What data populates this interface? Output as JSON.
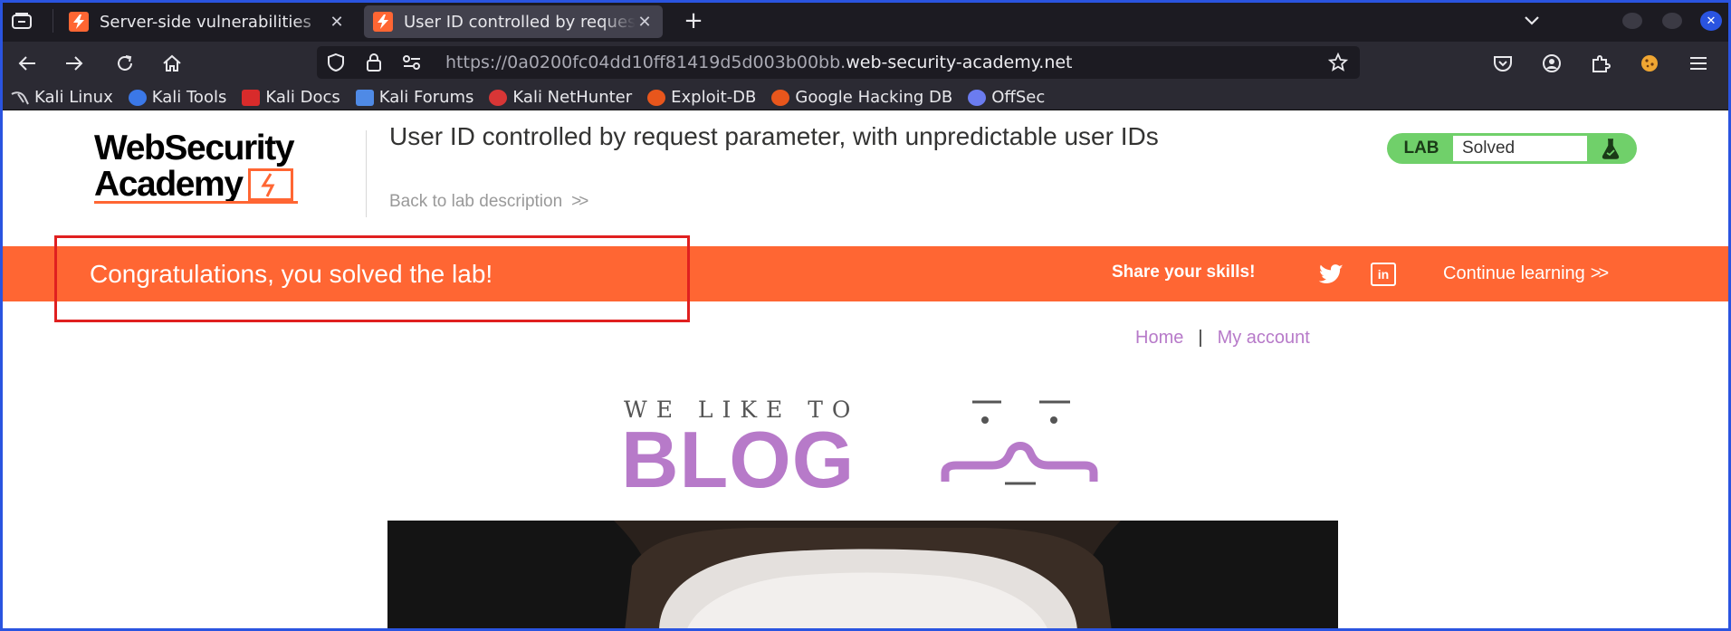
{
  "browser": {
    "tabs": [
      {
        "title": "Server-side vulnerabilities",
        "active": false
      },
      {
        "title": "User ID controlled by request parameter, with unpredictable user IDs",
        "active": true
      }
    ],
    "url_prefix": "https://0a0200fc04dd10ff81419d5d003b00bb.",
    "url_domain": "web-security-academy.net",
    "bookmarks": [
      {
        "label": "Kali Linux",
        "icon": "kali-dragon-icon",
        "color": "#1c1b22"
      },
      {
        "label": "Kali Tools",
        "icon": "kali-tools-icon",
        "color": "#3b78e7"
      },
      {
        "label": "Kali Docs",
        "icon": "kali-docs-icon",
        "color": "#d82b2b"
      },
      {
        "label": "Kali Forums",
        "icon": "kali-forums-icon",
        "color": "#4f8ae6"
      },
      {
        "label": "Kali NetHunter",
        "icon": "kali-nethunter-icon",
        "color": "#d83636"
      },
      {
        "label": "Exploit-DB",
        "icon": "exploit-db-icon",
        "color": "#e8561c"
      },
      {
        "label": "Google Hacking DB",
        "icon": "ghdb-icon",
        "color": "#e8561c"
      },
      {
        "label": "OffSec",
        "icon": "offsec-icon",
        "color": "#6b7cf0"
      }
    ]
  },
  "lab": {
    "logo_line1": "WebSecurity",
    "logo_line2": "Academy",
    "title": "User ID controlled by request parameter, with unpredictable user IDs",
    "back_link": "Back to lab description",
    "badge_label": "LAB",
    "status": "Solved",
    "accent_color": "#ff6633",
    "solved_color": "#70d06a"
  },
  "banner": {
    "message": "Congratulations, you solved the lab!",
    "share": "Share your skills!",
    "continue": "Continue learning",
    "linkedin_text": "in"
  },
  "blog": {
    "nav_home": "Home",
    "nav_separator": "|",
    "nav_account": "My account",
    "tagline": "WE LIKE TO",
    "wordmark": "BLOG",
    "brand_color": "#b77ac9"
  }
}
